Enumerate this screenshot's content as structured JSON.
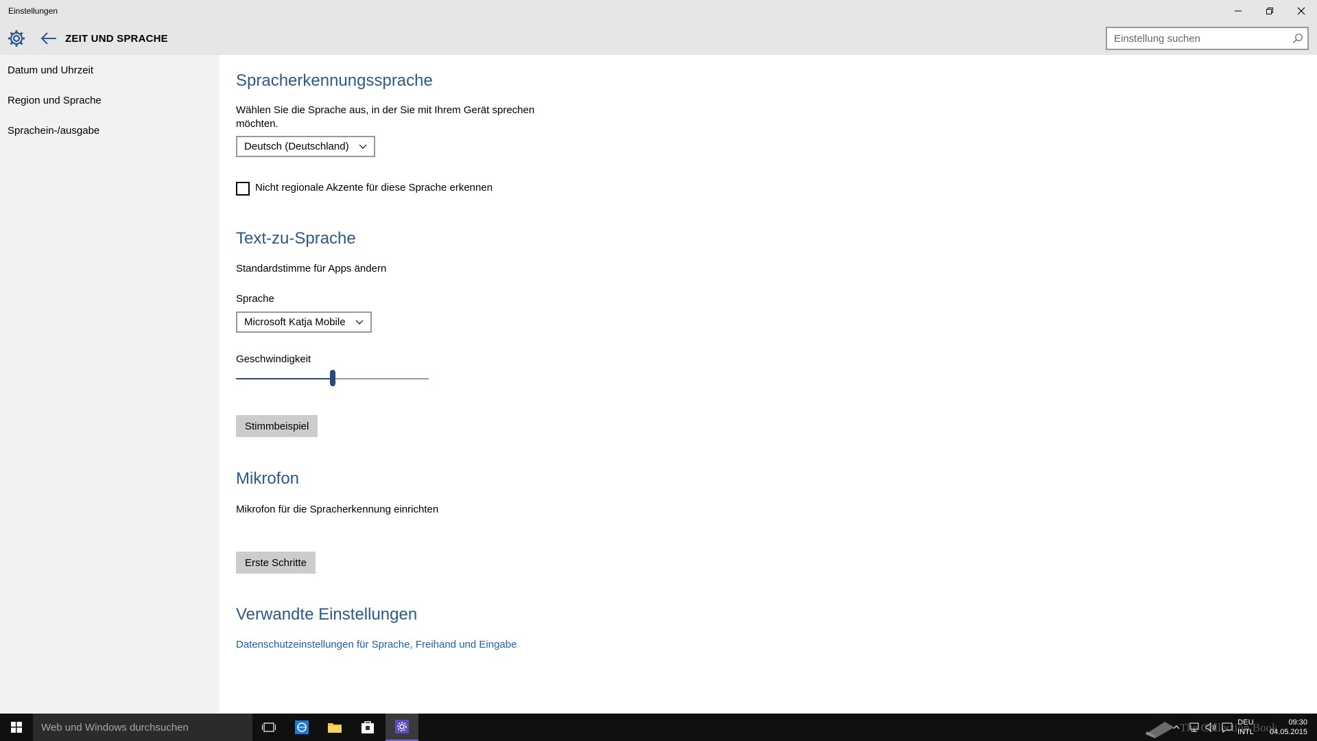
{
  "window": {
    "title": "Einstellungen"
  },
  "header": {
    "section_title": "ZEIT UND SPRACHE",
    "search_placeholder": "Einstellung suchen"
  },
  "sidebar": {
    "items": [
      {
        "label": "Datum und Uhrzeit"
      },
      {
        "label": "Region und Sprache"
      },
      {
        "label": "Sprachein-/ausgabe"
      }
    ]
  },
  "speech_recognition": {
    "heading": "Spracherkennungssprache",
    "description_line1": "Wählen Sie die Sprache aus, in der Sie mit Ihrem Gerät sprechen",
    "description_line2": "möchten.",
    "language_value": "Deutsch (Deutschland)",
    "accent_checkbox_label": "Nicht regionale Akzente für diese Sprache erkennen",
    "accent_checked": false
  },
  "tts": {
    "heading": "Text-zu-Sprache",
    "description": "Standardstimme für Apps ändern",
    "voice_label": "Sprache",
    "voice_value": "Microsoft Katja Mobile",
    "speed_label": "Geschwindigkeit",
    "speed_fraction": 0.5,
    "sample_button": "Stimmbeispiel"
  },
  "microphone": {
    "heading": "Mikrofon",
    "description": "Mikrofon für die Spracherkennung einrichten",
    "start_button": "Erste Schritte"
  },
  "related": {
    "heading": "Verwandte Einstellungen",
    "privacy_link": "Datenschutzeinstellungen für Sprache, Freihand und Eingabe"
  },
  "taskbar": {
    "search_placeholder": "Web und Windows durchsuchen",
    "lang_top": "DEU",
    "lang_bottom": "INTL",
    "time": "09:30",
    "date": "04.05.2015",
    "watermark": "The Collection Book"
  },
  "colors": {
    "accent": "#2a4a7a",
    "heading": "#2a5a8a",
    "link": "#1f5ea8",
    "active_task": "#7a6bd6"
  }
}
